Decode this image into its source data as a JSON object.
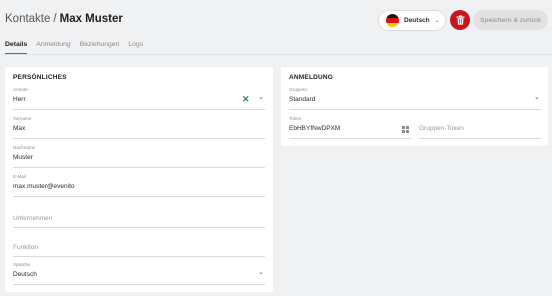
{
  "breadcrumb": {
    "parent": "Kontakte",
    "separator": "/",
    "current": "Max Muster"
  },
  "toolbar": {
    "language_label": "Deutsch",
    "language_icon": "german-flag-icon",
    "delete_icon": "trash-icon",
    "save_label": "Speichern & zurück"
  },
  "tabs": [
    {
      "label": "Details",
      "active": true
    },
    {
      "label": "Anmeldung",
      "active": false
    },
    {
      "label": "Beziehungen",
      "active": false
    },
    {
      "label": "Logs",
      "active": false
    }
  ],
  "personal": {
    "title": "PERSÖNLICHES",
    "anrede": {
      "label": "Anrede",
      "value": "Herr"
    },
    "vorname": {
      "label": "Vorname",
      "value": "Max"
    },
    "nachname": {
      "label": "Nachname",
      "value": "Muster"
    },
    "email": {
      "label": "E-Mail",
      "value": "max.muster@evenito"
    },
    "unternehmen": {
      "placeholder": "Unternehmen"
    },
    "funktion": {
      "placeholder": "Funktion"
    },
    "sprache": {
      "label": "Sprache",
      "value": "Deutsch"
    }
  },
  "login": {
    "title": "ANMELDUNG",
    "gruppen": {
      "label": "Gruppen",
      "value": "Standard"
    },
    "token": {
      "label": "Token",
      "value": "EbHBYfNwDPXM"
    },
    "gruppen_token": {
      "placeholder": "Gruppen-Token"
    }
  },
  "colors": {
    "accent": "#2b8b79",
    "danger": "#c8161d",
    "background": "#f0f1f3"
  }
}
